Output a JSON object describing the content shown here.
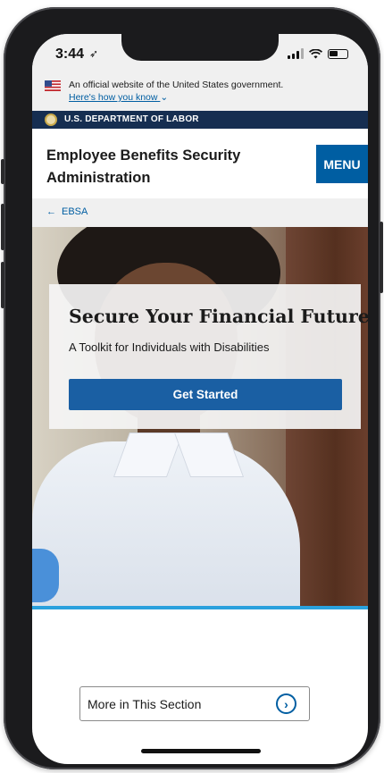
{
  "status_bar": {
    "time": "3:44"
  },
  "gov_banner": {
    "text": "An official website of the United States government.",
    "link": "Here's how you know"
  },
  "dol_bar": {
    "label": "U.S. DEPARTMENT OF LABOR"
  },
  "header": {
    "title": "Employee Benefits Security Administration",
    "menu_label": "MENU"
  },
  "breadcrumb": {
    "label": "EBSA"
  },
  "hero": {
    "title": "Secure Your Financial Future",
    "subtitle": "A Toolkit for Individuals with Disabilities",
    "button_label": "Get Started"
  },
  "more_section": {
    "label": "More in This Section"
  },
  "colors": {
    "primary": "#005ea2",
    "navy": "#162e51",
    "accent": "#2aa1dd"
  }
}
